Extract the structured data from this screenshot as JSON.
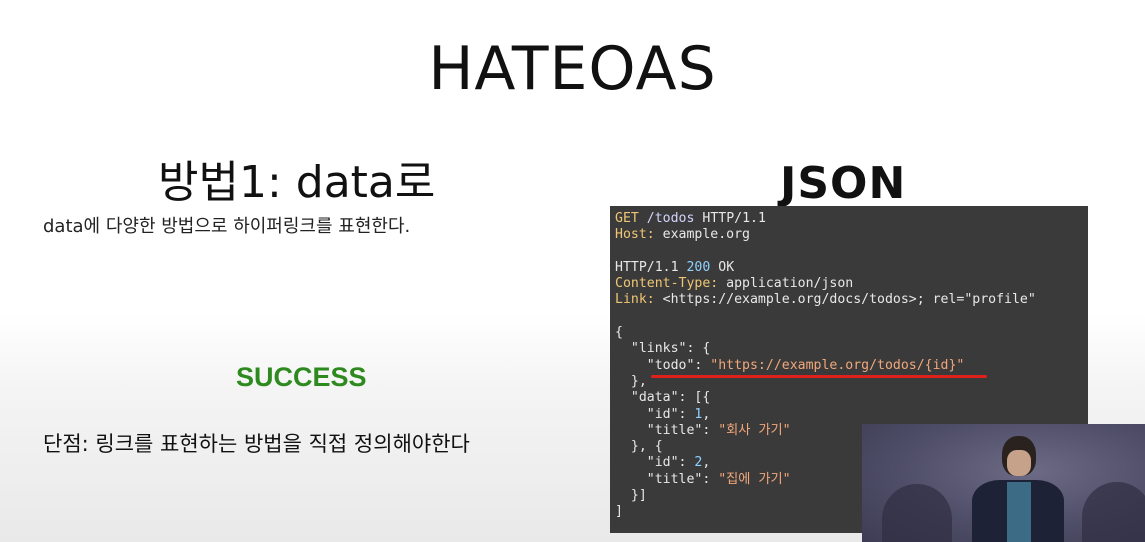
{
  "slide": {
    "title": "HATEOAS",
    "method_heading": "방법1: data로",
    "description": "data에 다양한 방법으로 하이퍼링크를 표현한다.",
    "success_label": "SUCCESS",
    "drawback": "단점: 링크를 표현하는 방법을 직접 정의해야한다",
    "json_heading": "JSON"
  },
  "code": {
    "request_method": "GET",
    "request_path": "/todos",
    "request_protocol": "HTTP/1.1",
    "host_key": "Host:",
    "host_value": "example.org",
    "status_protocol": "HTTP/1.1",
    "status_code": "200",
    "status_text": "OK",
    "content_type_key": "Content-Type:",
    "content_type_value": "application/json",
    "link_key": "Link:",
    "link_value": "<https://example.org/docs/todos>; rel=\"profile\"",
    "open_brace": "{",
    "links_line": "  \"links\": {",
    "todo_key": "\"todo\"",
    "todo_value": "\"https://example.org/todos/{id}\"",
    "links_close": "  },",
    "data_line": "  \"data\": [{",
    "id_key": "\"id\"",
    "id1": "1",
    "title_key": "\"title\"",
    "title1": "\"회사 가기\"",
    "mid_close": "  }, {",
    "id2": "2",
    "title2": "\"집에 가기\"",
    "data_close": "  }]",
    "close_brace": "]"
  },
  "colors": {
    "success": "#2e8a1e",
    "code_bg": "#3a3a3a",
    "underline": "#e0201a"
  }
}
